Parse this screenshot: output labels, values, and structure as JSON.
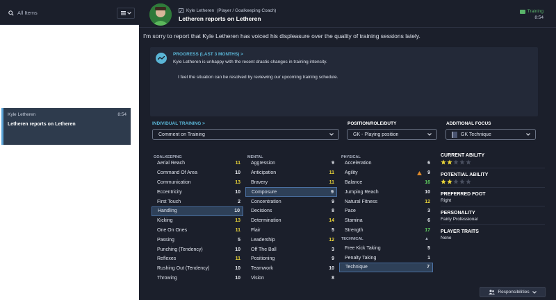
{
  "sidebar": {
    "search_placeholder": "All Items",
    "filter_icon": "list-icon",
    "message": {
      "sender": "Kyle Letheren",
      "time": "8:54",
      "subject": "Letheren reports on Letheren"
    }
  },
  "header": {
    "from": "Kyle Letheren",
    "from_role": "(Player / Goalkeeping Coach)",
    "subject": "Letheren reports on Letheren",
    "tag": "Training",
    "time": "8:54"
  },
  "body": "I'm sorry to report that Kyle Letheren has voiced his displeasure over the quality of training sessions lately.",
  "progress": {
    "title": "PROGRESS (LAST 3 MONTHS) >",
    "line1": "Kyle Letheren is unhappy with the recent drastic changes in training intensity.",
    "line2": "I feel the situation can be resolved by reviewing our upcoming training schedule."
  },
  "controls": {
    "individual_training": {
      "label": "INDIVIDUAL TRAINING >",
      "value": "Comment on Training"
    },
    "position": {
      "label": "POSITION/ROLE/DUTY",
      "value": "GK - Playing position"
    },
    "additional_focus": {
      "label": "ADDITIONAL FOCUS",
      "value": "GK Technique"
    }
  },
  "attributes": {
    "goalkeeping": {
      "title": "GOALKEEPING",
      "items": [
        {
          "name": "Aerial Reach",
          "value": "11",
          "color": "yellow"
        },
        {
          "name": "Command Of Area",
          "value": "10",
          "color": "white"
        },
        {
          "name": "Communication",
          "value": "13",
          "color": "yellow"
        },
        {
          "name": "Eccentricity",
          "value": "10",
          "color": "white"
        },
        {
          "name": "First Touch",
          "value": "2",
          "color": "white"
        },
        {
          "name": "Handling",
          "value": "10",
          "color": "white",
          "selected": true
        },
        {
          "name": "Kicking",
          "value": "13",
          "color": "yellow"
        },
        {
          "name": "One On Ones",
          "value": "11",
          "color": "yellow"
        },
        {
          "name": "Passing",
          "value": "5",
          "color": "white"
        },
        {
          "name": "Punching (Tendency)",
          "value": "10",
          "color": "white"
        },
        {
          "name": "Reflexes",
          "value": "11",
          "color": "yellow"
        },
        {
          "name": "Rushing Out (Tendency)",
          "value": "10",
          "color": "white"
        },
        {
          "name": "Throwing",
          "value": "10",
          "color": "white"
        }
      ]
    },
    "mental": {
      "title": "MENTAL",
      "items": [
        {
          "name": "Aggression",
          "value": "9",
          "color": "white"
        },
        {
          "name": "Anticipation",
          "value": "11",
          "color": "yellow"
        },
        {
          "name": "Bravery",
          "value": "11",
          "color": "yellow"
        },
        {
          "name": "Composure",
          "value": "9",
          "color": "white",
          "selected": true
        },
        {
          "name": "Concentration",
          "value": "9",
          "color": "white"
        },
        {
          "name": "Decisions",
          "value": "8",
          "color": "white"
        },
        {
          "name": "Determination",
          "value": "14",
          "color": "yellow"
        },
        {
          "name": "Flair",
          "value": "5",
          "color": "white"
        },
        {
          "name": "Leadership",
          "value": "12",
          "color": "yellow"
        },
        {
          "name": "Off The Ball",
          "value": "3",
          "color": "white"
        },
        {
          "name": "Positioning",
          "value": "9",
          "color": "white"
        },
        {
          "name": "Teamwork",
          "value": "10",
          "color": "white"
        },
        {
          "name": "Vision",
          "value": "8",
          "color": "white"
        }
      ]
    },
    "physical": {
      "title": "PHYSICAL",
      "items": [
        {
          "name": "Acceleration",
          "value": "6",
          "color": "white"
        },
        {
          "name": "Agility",
          "value": "9",
          "color": "white",
          "warn": true
        },
        {
          "name": "Balance",
          "value": "16",
          "color": "green"
        },
        {
          "name": "Jumping Reach",
          "value": "10",
          "color": "white"
        },
        {
          "name": "Natural Fitness",
          "value": "12",
          "color": "yellow"
        },
        {
          "name": "Pace",
          "value": "3",
          "color": "white"
        },
        {
          "name": "Stamina",
          "value": "6",
          "color": "white"
        },
        {
          "name": "Strength",
          "value": "17",
          "color": "green"
        }
      ]
    },
    "technical": {
      "title": "TECHNICAL",
      "items": [
        {
          "name": "Free Kick Taking",
          "value": "5",
          "color": "white"
        },
        {
          "name": "Penalty Taking",
          "value": "1",
          "color": "white"
        },
        {
          "name": "Technique",
          "value": "7",
          "color": "white",
          "selected": true
        }
      ]
    }
  },
  "info": {
    "current_ability": {
      "label": "CURRENT ABILITY",
      "stars": 2,
      "max": 5
    },
    "potential_ability": {
      "label": "POTENTIAL ABILITY",
      "stars": 2,
      "max": 5
    },
    "preferred_foot": {
      "label": "PREFERRED FOOT",
      "value": "Right"
    },
    "personality": {
      "label": "PERSONALITY",
      "value": "Fairly Professional"
    },
    "player_traits": {
      "label": "PLAYER TRAITS",
      "value": "None"
    }
  },
  "footer": {
    "responsibilities_label": "Responsibilities"
  },
  "colors": {
    "accent": "#5ab5d6",
    "training_tag": "#5ab56b",
    "yellow": "#e9d43a",
    "green": "#5fd15f"
  }
}
